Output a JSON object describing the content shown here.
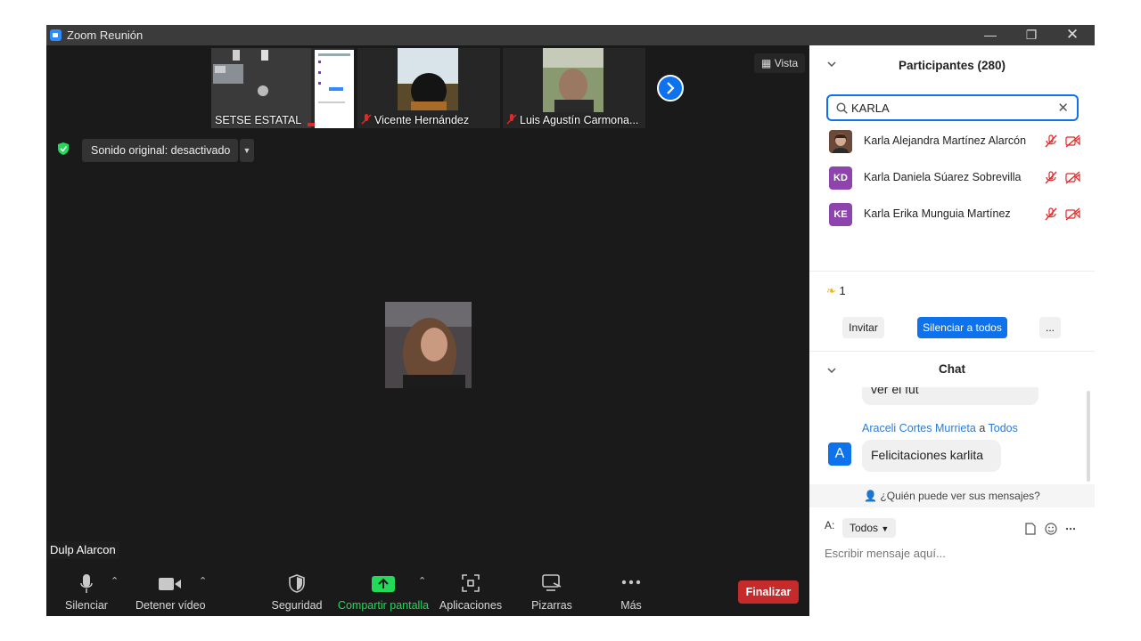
{
  "window": {
    "title": "Zoom Reunión"
  },
  "thumbnails": [
    {
      "name": "SETSE ESTATAL",
      "muted": false
    },
    {
      "name": "Vicente Hernández",
      "muted": true
    },
    {
      "name": "Luis Agustín Carmona...",
      "muted": true
    }
  ],
  "view_label": "Vista",
  "audio": {
    "label": "Sonido original: desactivado"
  },
  "speaker": {
    "name": "Dulp Alarcon"
  },
  "toolbar": {
    "mute": "Silenciar",
    "video": "Detener vídeo",
    "security": "Seguridad",
    "share": "Compartir pantalla",
    "apps": "Aplicaciones",
    "whiteboards": "Pizarras",
    "more": "Más",
    "end": "Finalizar"
  },
  "participants": {
    "title": "Participantes (280)",
    "search_value": "KARLA",
    "list": [
      {
        "initials": "",
        "name": "Karla Alejandra Martínez Alarcón",
        "color": "#6b4a3a"
      },
      {
        "initials": "KD",
        "name": "Karla Daniela  Súarez Sobrevilla",
        "color": "#8e44ad"
      },
      {
        "initials": "KE",
        "name": "Karla Erika Munguia Martínez",
        "color": "#8e44ad"
      }
    ],
    "reaction_count": "1",
    "invite": "Invitar",
    "mute_all": "Silenciar a todos",
    "more": "..."
  },
  "chat": {
    "title": "Chat",
    "prev_message": "ver el fut",
    "sender": "Araceli Cortes Murrieta",
    "to_word": "a",
    "recipient": "Todos",
    "sender_initial": "A",
    "message": "Felicitaciones karlita",
    "who_can_see": "¿Quién puede ver sus mensajes?",
    "to_label": "A:",
    "to_value": "Todos",
    "placeholder": "Escribir mensaje aquí..."
  },
  "colors": {
    "accent": "#0e72ed",
    "end": "#c72a2a",
    "share": "#23d959",
    "muted": "#e02828"
  }
}
